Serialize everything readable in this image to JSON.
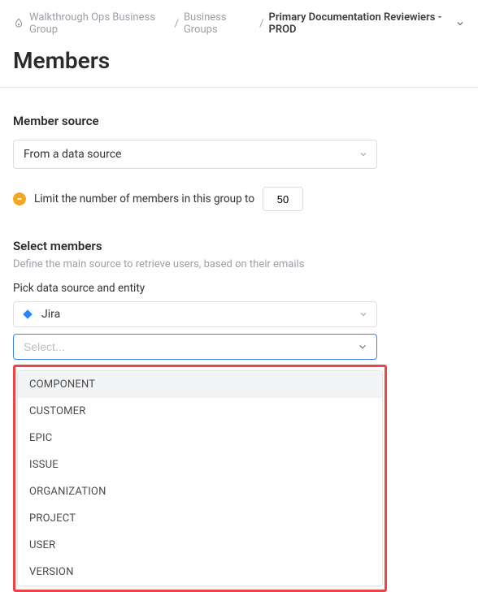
{
  "breadcrumb": {
    "items": [
      "Walkthrough Ops Business Group",
      "Business Groups",
      "Primary Documentation Reviewiers - PROD"
    ]
  },
  "page": {
    "title": "Members"
  },
  "memberSource": {
    "heading": "Member source",
    "value": "From a data source"
  },
  "limit": {
    "label": "Limit the number of members in this group to",
    "value": "50"
  },
  "selectMembers": {
    "heading": "Select members",
    "hint": "Define the main source to retrieve users, based on their emails",
    "pickLabel": "Pick data source and entity",
    "dataSource": "Jira",
    "entityPlaceholder": "Select...",
    "options": [
      "COMPONENT",
      "CUSTOMER",
      "EPIC",
      "ISSUE",
      "ORGANIZATION",
      "PROJECT",
      "USER",
      "VERSION"
    ]
  }
}
